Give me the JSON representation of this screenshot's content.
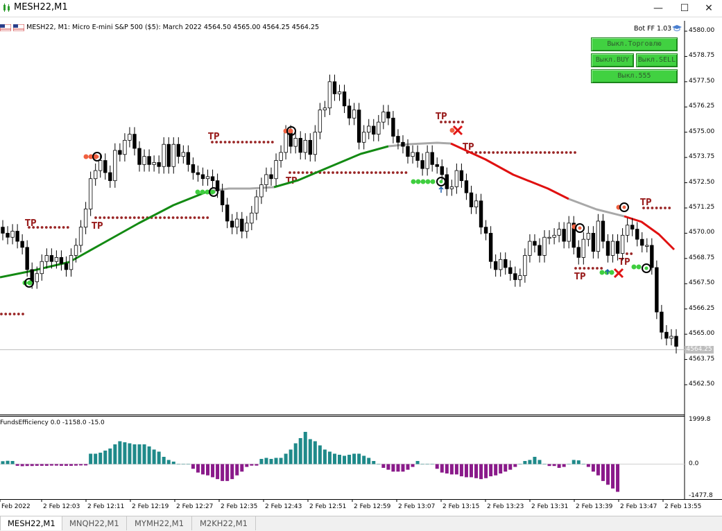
{
  "window": {
    "title": "MESH22,M1",
    "minimize": "—",
    "maximize": "☐",
    "close": "✕"
  },
  "chart": {
    "header": "MESH22, M1:  Micro E-mini S&P 500 ($5): March 2022  4564.50 4565.00 4564.25 4564.25",
    "bot_label": "Bot FF 1.03",
    "current_price": "4564.25"
  },
  "panel": {
    "trade_off": "Выкл.Торговлю",
    "buy_off": "Выкл.BUY",
    "sell_off": "Выкл.SELL",
    "off_555": "Выкл.555"
  },
  "indicator": {
    "label": "FundsEfficiency 0.0 -1158.0 -15.0",
    "axis_labels": [
      "1999.8",
      "0.0",
      "-1477.8"
    ]
  },
  "chart_data": {
    "type": "candlestick",
    "symbol": "MESH22",
    "timeframe": "M1",
    "y_axis_labels": [
      "4580.00",
      "4578.75",
      "4577.50",
      "4576.25",
      "4575.00",
      "4573.75",
      "4572.50",
      "4571.25",
      "4570.00",
      "4568.75",
      "4567.50",
      "4566.25",
      "4565.00",
      "4563.75",
      "4562.50"
    ],
    "x_axis_labels": [
      "Feb 2022",
      "2 Feb 12:03",
      "2 Feb 12:11",
      "2 Feb 12:19",
      "2 Feb 12:27",
      "2 Feb 12:35",
      "2 Feb 12:43",
      "2 Feb 12:51",
      "2 Feb 12:59",
      "2 Feb 13:07",
      "2 Feb 13:15",
      "2 Feb 13:23",
      "2 Feb 13:31",
      "2 Feb 13:39",
      "2 Feb 13:47",
      "2 Feb 13:55"
    ],
    "tp_label": "TP"
  },
  "colors": {
    "ma_up": "#138a13",
    "ma_flat": "#a8a8a8",
    "ma_down": "#e01010",
    "tp_dots": "#9a2626",
    "hist_pos": "#1f8a8a",
    "hist_neg": "#8a1a8a",
    "panel_green": "#41d141"
  },
  "tabs": [
    {
      "label": "MESH22,M1",
      "active": true
    },
    {
      "label": "MNQH22,M1",
      "active": false
    },
    {
      "label": "MYMH22,M1",
      "active": false
    },
    {
      "label": "M2KH22,M1",
      "active": false
    }
  ]
}
